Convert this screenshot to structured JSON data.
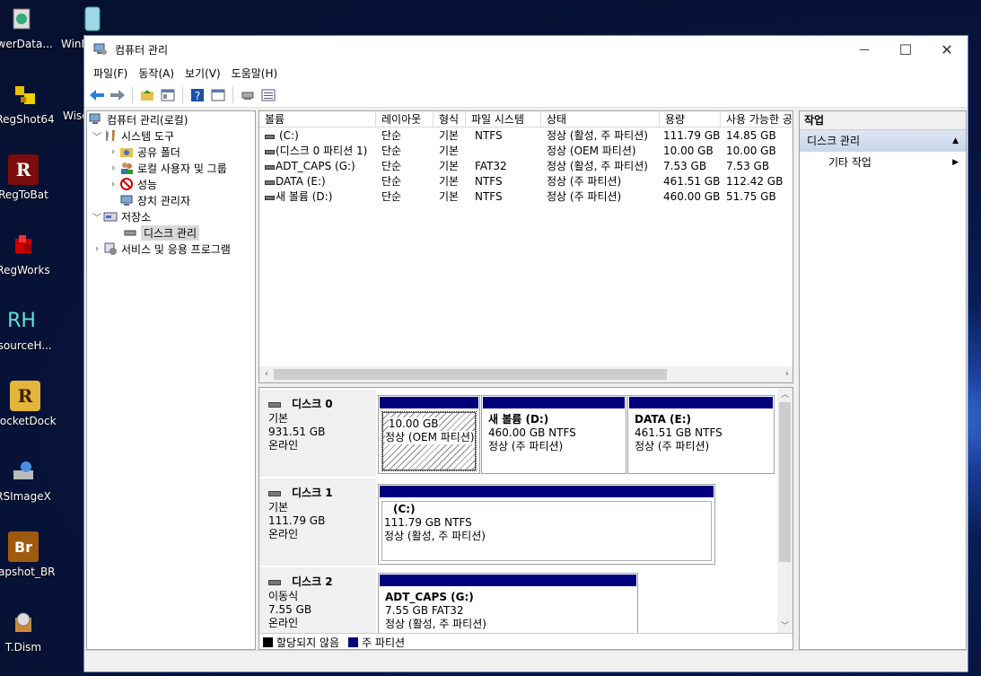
{
  "desktop": {
    "icons": [
      {
        "label": "owerData...",
        "icon": "power-data-icon"
      },
      {
        "label": "WinN",
        "icon": "win-icon"
      },
      {
        "label": "RegShot64",
        "icon": "regshot-icon"
      },
      {
        "label": "Wise",
        "icon": "wise-icon"
      },
      {
        "label": "RegToBat",
        "icon": "regtobat-icon"
      },
      {
        "label": "RegWorks",
        "icon": "regworks-icon"
      },
      {
        "label": "esourceH...",
        "icon": "resource-hacker-icon"
      },
      {
        "label": "LocketDock",
        "icon": "rocketdock-icon"
      },
      {
        "label": "RSImageX",
        "icon": "rsimagex-icon"
      },
      {
        "label": "napshot_BR",
        "icon": "snapshot-br-icon"
      },
      {
        "label": "T.Dism",
        "icon": "tdism-icon"
      }
    ],
    "icon_glyphs": {
      "regtobat": "R",
      "resourceh": "RH",
      "rocketdock": "R",
      "snapshot": "Br"
    }
  },
  "window": {
    "title": "컴퓨터 관리",
    "controls": {
      "minimize": "—",
      "maximize": "☐",
      "close": "✕"
    }
  },
  "menu": [
    "파일(F)",
    "동작(A)",
    "보기(V)",
    "도움말(H)"
  ],
  "tree": {
    "root": "컴퓨터 관리(로컬)",
    "system_tools": "시스템 도구",
    "shared_folders": "공유 폴더",
    "local_users": "로컬 사용자 및 그룹",
    "performance": "성능",
    "device_manager": "장치 관리자",
    "storage": "저장소",
    "disk_management": "디스크 관리",
    "services": "서비스 및 응용 프로그램"
  },
  "volume_table": {
    "columns": [
      "볼륨",
      "레이아웃",
      "형식",
      "파일 시스템",
      "상태",
      "용량",
      "사용 가능한 공"
    ],
    "rows": [
      [
        "(C:)",
        "단순",
        "기본",
        "NTFS",
        "정상 (활성, 주 파티션)",
        "111.79 GB",
        "14.85 GB"
      ],
      [
        "(디스크 0 파티션 1)",
        "단순",
        "기본",
        "",
        "정상 (OEM 파티션)",
        "10.00 GB",
        "10.00 GB"
      ],
      [
        "ADT_CAPS (G:)",
        "단순",
        "기본",
        "FAT32",
        "정상 (활성, 주 파티션)",
        "7.53 GB",
        "7.53 GB"
      ],
      [
        "DATA (E:)",
        "단순",
        "기본",
        "NTFS",
        "정상 (주 파티션)",
        "461.51 GB",
        "112.42 GB"
      ],
      [
        "새 볼륨 (D:)",
        "단순",
        "기본",
        "NTFS",
        "정상 (주 파티션)",
        "460.00 GB",
        "51.75 GB"
      ]
    ]
  },
  "disks": [
    {
      "name": "디스크 0",
      "type": "기본",
      "size": "931.51 GB",
      "status": "온라인",
      "partitions": [
        {
          "name": "",
          "size": "10.00 GB",
          "status": "정상 (OEM 파티션)"
        },
        {
          "name": "새 볼륨   (D:)",
          "size": "460.00 GB NTFS",
          "status": "정상 (주 파티션)"
        },
        {
          "name": "DATA   (E:)",
          "size": "461.51 GB NTFS",
          "status": "정상 (주 파티션)"
        }
      ]
    },
    {
      "name": "디스크 1",
      "type": "기본",
      "size": "111.79 GB",
      "status": "온라인",
      "partitions": [
        {
          "name": "(C:)",
          "size": "111.79 GB NTFS",
          "status": "정상 (활성, 주 파티션)"
        }
      ]
    },
    {
      "name": "디스크 2",
      "type": "이동식",
      "size": "7.55 GB",
      "status": "온라인",
      "partitions": [
        {
          "name": "ADT_CAPS   (G:)",
          "size": "7.55 GB FAT32",
          "status": "정상 (활성, 주 파티션)"
        }
      ]
    }
  ],
  "legend": {
    "unallocated": "할당되지 않음",
    "primary": "주 파티션",
    "unallocated_color": "#000000",
    "primary_color": "#00007d"
  },
  "actions": {
    "header": "작업",
    "group": "디스크 관리",
    "item": "기타 작업"
  }
}
